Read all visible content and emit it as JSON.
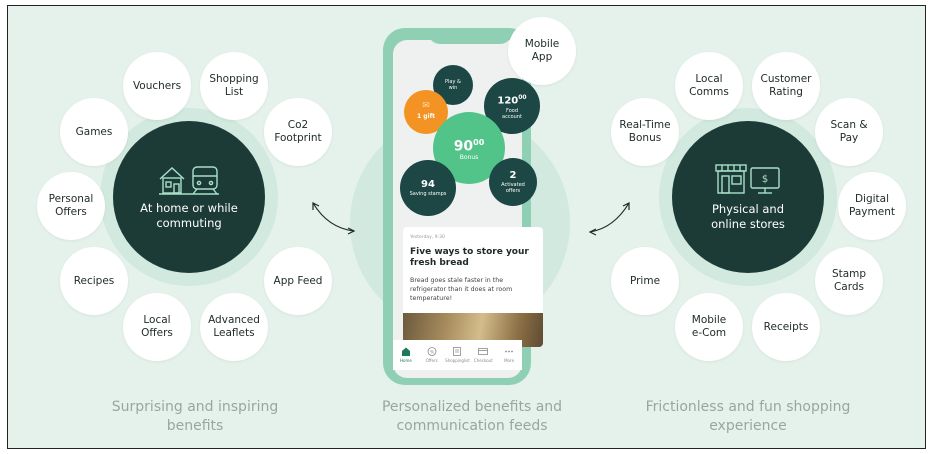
{
  "left_group": {
    "hub_label": "At home or while commuting",
    "bubbles": [
      "Vouchers",
      "Shopping List",
      "Games",
      "Co2 Footprint",
      "Personal Offers",
      "Recipes",
      "App Feed",
      "Local Offers",
      "Advanced Leaflets"
    ],
    "caption": "Surprising and inspiring benefits"
  },
  "center_group": {
    "bubble": "Mobile App",
    "caption": "Personalized benefits and communication feeds",
    "phone": {
      "play_win": "Play & win",
      "gift": "1 gift",
      "food_account_value": "120",
      "food_account_cents": "00",
      "food_account_label": "Food account",
      "bonus_value": "90",
      "bonus_cents": "00",
      "bonus_label": "Bonus",
      "saving_stamps_value": "94",
      "saving_stamps_label": "Saving stamps",
      "activated_value": "2",
      "activated_label": "Activated offers",
      "feed_date": "Yesterday, 9:30",
      "feed_title": "Five ways to store your fresh bread",
      "feed_text": "Bread goes stale faster in the refrigerator than it does at room temperature!",
      "nav": [
        "Home",
        "Offers",
        "Shoppinglist",
        "Checkout",
        "More"
      ]
    }
  },
  "right_group": {
    "hub_label": "Physical and online stores",
    "bubbles": [
      "Local Comms",
      "Customer Rating",
      "Real-Time Bonus",
      "Scan & Pay",
      "Digital Payment",
      "Prime",
      "Stamp Cards",
      "Mobile e-Com",
      "Receipts"
    ],
    "caption": "Frictionless and fun shopping experience"
  },
  "colors": {
    "background": "#e5f2ec",
    "hub": "#1c3b37",
    "phone_frame": "#8fd0b5",
    "bonus_green": "#52c48a",
    "gift_orange": "#f39323",
    "stat_dark": "#1c4745"
  }
}
